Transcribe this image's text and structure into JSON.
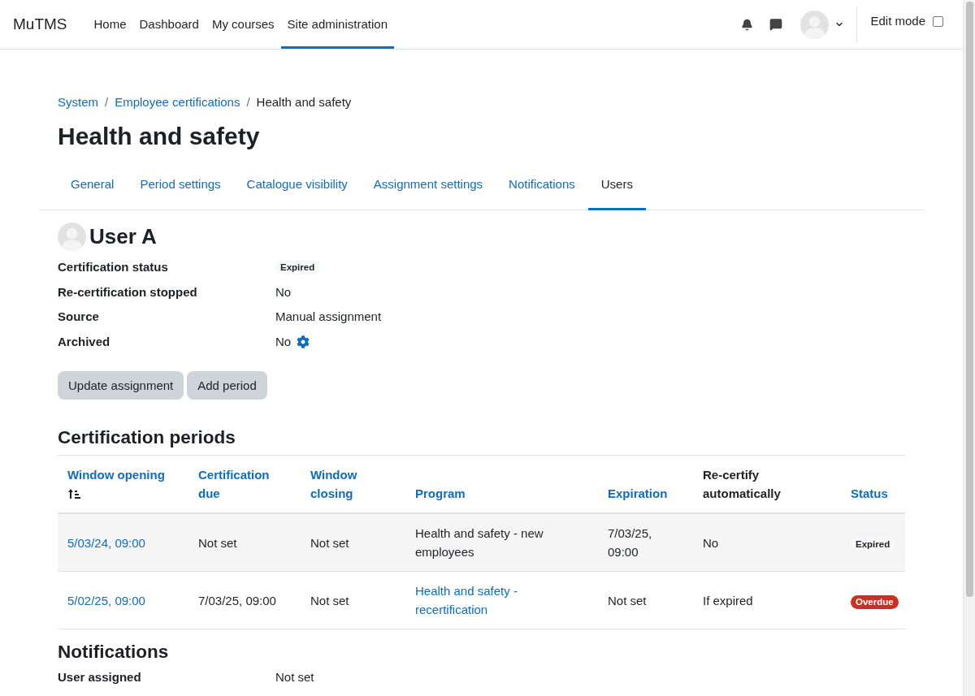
{
  "navbar": {
    "brand": "MuTMS",
    "links": [
      {
        "label": "Home",
        "selected": false
      },
      {
        "label": "Dashboard",
        "selected": false
      },
      {
        "label": "My courses",
        "selected": false
      },
      {
        "label": "Site administration",
        "selected": true
      }
    ],
    "edit_mode": {
      "label": "Edit mode",
      "checked": false
    }
  },
  "breadcrumb": [
    {
      "label": "System",
      "kind": "link"
    },
    {
      "label": "/",
      "kind": "separator"
    },
    {
      "label": "Employee certifications",
      "kind": "link"
    },
    {
      "label": "/",
      "kind": "separator"
    },
    {
      "label": "Health and safety",
      "kind": "current"
    }
  ],
  "title": "Health and safety",
  "tabs": [
    {
      "label": "General",
      "selected": false
    },
    {
      "label": "Period settings",
      "selected": false
    },
    {
      "label": "Catalogue visibility",
      "selected": false
    },
    {
      "label": "Assignment settings",
      "selected": false
    },
    {
      "label": "Notifications",
      "selected": false
    },
    {
      "label": "Users",
      "selected": true
    }
  ],
  "user": {
    "name": "User A",
    "details": [
      {
        "label": "Certification status",
        "value": "Expired",
        "kind": "badge",
        "color": "#f8f9fa"
      },
      {
        "label": "Re-certification stopped",
        "value": "No",
        "kind": "text"
      },
      {
        "label": "Source",
        "value": "Manual assignment",
        "kind": "text"
      },
      {
        "label": "Archived",
        "value": "No",
        "kind": "settings"
      }
    ]
  },
  "buttons": [
    "Update assignment",
    "Add period"
  ],
  "periods": {
    "title": "Certification periods",
    "columns": [
      {
        "label": "Window opening",
        "sortable": true,
        "sorted": true
      },
      {
        "label": "Certification due",
        "sortable": true,
        "sorted": false
      },
      {
        "label": "Window closing",
        "sortable": true,
        "sorted": false
      },
      {
        "label": "Program",
        "sortable": true,
        "sorted": false
      },
      {
        "label": "Expiration",
        "sortable": true,
        "sorted": false
      },
      {
        "label": "Re-certify automatically",
        "sortable": false,
        "sorted": false
      },
      {
        "label": "Status",
        "sortable": true,
        "sorted": false
      }
    ],
    "rows": [
      {
        "cells": [
          {
            "text": "5/03/24, 09:00",
            "kind": "link"
          },
          {
            "text": "Not set",
            "kind": "text"
          },
          {
            "text": "Not set",
            "kind": "text"
          },
          {
            "text": "Health and safety - new employees",
            "kind": "text"
          },
          {
            "text": "7/03/25, 09:00",
            "kind": "text"
          },
          {
            "text": "No",
            "kind": "text"
          },
          {
            "text": "Expired",
            "kind": "badge",
            "color": "#f8f9fa"
          }
        ]
      },
      {
        "cells": [
          {
            "text": "5/02/25, 09:00",
            "kind": "link"
          },
          {
            "text": "7/03/25, 09:00",
            "kind": "text"
          },
          {
            "text": "Not set",
            "kind": "text"
          },
          {
            "text": "Health and safety - recertification",
            "kind": "link"
          },
          {
            "text": "Not set",
            "kind": "text"
          },
          {
            "text": "If expired",
            "kind": "text"
          },
          {
            "text": "Overdue",
            "kind": "badge",
            "color": "#ca3120"
          }
        ]
      }
    ]
  },
  "notifications": {
    "title": "Notifications",
    "items": [
      {
        "label": "User assigned",
        "value": "Not set"
      }
    ]
  }
}
